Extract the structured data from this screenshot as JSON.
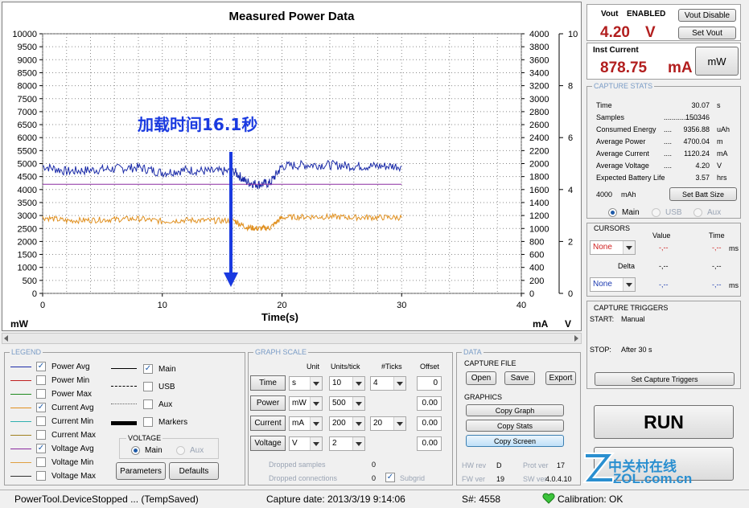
{
  "chart": {
    "title": "Measured Power Data",
    "annotation": "加载时间16.1秒",
    "xlabel": "Time(s)",
    "left_unit": "mW",
    "right_unit_1": "mA",
    "right_unit_2": "V",
    "x_ticks": [
      "0",
      "10",
      "20",
      "30",
      "40"
    ],
    "left_ticks": [
      "10000",
      "9500",
      "9000",
      "8500",
      "8000",
      "7500",
      "7000",
      "6500",
      "6000",
      "5500",
      "5000",
      "4500",
      "4000",
      "3500",
      "3000",
      "2500",
      "2000",
      "1500",
      "1000",
      "500",
      "0"
    ],
    "mid_ticks": [
      "4000",
      "3800",
      "3600",
      "3400",
      "3200",
      "3000",
      "2800",
      "2600",
      "2400",
      "2200",
      "2000",
      "1800",
      "1600",
      "1400",
      "1200",
      "1000",
      "800",
      "600",
      "400",
      "200",
      "0"
    ],
    "right_ticks": [
      "10",
      "8",
      "6",
      "4",
      "2",
      "0"
    ]
  },
  "chart_data": {
    "type": "line",
    "title": "Measured Power Data",
    "xlabel": "Time(s)",
    "ylabel": "mW",
    "xlim": [
      0,
      40
    ],
    "ylim": [
      0,
      10000
    ],
    "grid": true,
    "series": [
      {
        "name": "Power Avg",
        "color": "#1c2ca8",
        "x": [
          0,
          2,
          4,
          6,
          8,
          10,
          12,
          14,
          16,
          17,
          18,
          19,
          20,
          22,
          24,
          26,
          28,
          30
        ],
        "values": [
          4900,
          4700,
          4750,
          4800,
          4850,
          4650,
          4750,
          4700,
          4700,
          4300,
          4200,
          4250,
          4900,
          4950,
          4950,
          4900,
          4900,
          4900
        ]
      },
      {
        "name": "Voltage Avg",
        "color": "#8a2ba0",
        "x": [
          0,
          30
        ],
        "values": [
          4.2,
          4.2
        ]
      },
      {
        "name": "Current Avg",
        "color": "#e09020",
        "x": [
          0,
          2,
          4,
          6,
          8,
          10,
          12,
          14,
          16,
          17,
          18,
          19,
          20,
          22,
          24,
          26,
          28,
          30
        ],
        "values": [
          1170,
          1120,
          1130,
          1140,
          1150,
          1110,
          1130,
          1120,
          1120,
          1020,
          1000,
          1010,
          1170,
          1180,
          1180,
          1170,
          1170,
          1170
        ]
      }
    ]
  },
  "top_right": {
    "vout_label": "Vout",
    "vout_state": "ENABLED",
    "vout_value": "4.20",
    "vout_unit": "V",
    "vout_disable": "Vout Disable",
    "set_vout": "Set Vout",
    "inst_current_label": "Inst Current",
    "inst_current_value": "878.75",
    "inst_current_unit": "mA",
    "mw_button": "mW"
  },
  "capture_stats": {
    "title": "CAPTURE STATS",
    "rows": [
      {
        "label": "Time",
        "dots": "",
        "value": "30.07",
        "unit": "s"
      },
      {
        "label": "Samples",
        "dots": "..................",
        "value": "150346",
        "unit": ""
      },
      {
        "label": "Consumed Energy",
        "dots": "....",
        "value": "9356.88",
        "unit": "uAh"
      },
      {
        "label": "Average Power",
        "dots": "....",
        "value": "4700.04",
        "unit": "m"
      },
      {
        "label": "Average Current",
        "dots": "....",
        "value": "1120.24",
        "unit": "mA"
      },
      {
        "label": "Average Voltage",
        "dots": "....",
        "value": "4.20",
        "unit": "V"
      },
      {
        "label": "Expected Battery Life",
        "dots": "",
        "value": "3.57",
        "unit": "hrs"
      }
    ],
    "battery_value": "4000",
    "battery_unit": "mAh",
    "set_batt": "Set Batt Size",
    "radio_main": "Main",
    "radio_usb": "USB",
    "radio_aux": "Aux"
  },
  "cursors": {
    "title": "CURSORS",
    "col_value": "Value",
    "col_time": "Time",
    "col_delta": "Delta",
    "sel1": "None",
    "sel2": "None",
    "v1": "-,--",
    "t1": "-,--",
    "u1": "ms",
    "v2": "-,--",
    "t2": "-,--",
    "d1": "-,--",
    "d2": "-,--",
    "v3": "-,--",
    "t3": "-,--",
    "u3": "ms"
  },
  "triggers": {
    "title": "CAPTURE TRIGGERS",
    "start_label": "START:",
    "start_value": "Manual",
    "stop_label": "STOP:",
    "stop_value": "After 30 s",
    "set_button": "Set Capture Triggers"
  },
  "run_button": "RUN",
  "legend": {
    "title": "LEGEND",
    "items": [
      {
        "label": "Power Avg",
        "color": "#1c2ca8",
        "checked": "✓"
      },
      {
        "label": "Power Min",
        "color": "#c02020",
        "checked": ""
      },
      {
        "label": "Power Max",
        "color": "#208a20",
        "checked": ""
      },
      {
        "label": "Current Avg",
        "color": "#e09020",
        "checked": "✓"
      },
      {
        "label": "Current Min",
        "color": "#30b0b0",
        "checked": ""
      },
      {
        "label": "Current Max",
        "color": "#a08020",
        "checked": ""
      },
      {
        "label": "Voltage Avg",
        "color": "#8a2ba0",
        "checked": "✓"
      },
      {
        "label": "Voltage Min",
        "color": "#e0a040",
        "checked": ""
      },
      {
        "label": "Voltage Max",
        "color": "#303030",
        "checked": ""
      }
    ],
    "sources": [
      {
        "label": "Main",
        "checked": "✓"
      },
      {
        "label": "USB",
        "checked": ""
      },
      {
        "label": "Aux",
        "checked": ""
      },
      {
        "label": "Markers",
        "checked": ""
      }
    ],
    "voltage_title": "VOLTAGE",
    "voltage_main": "Main",
    "voltage_aux": "Aux",
    "parameters": "Parameters",
    "defaults": "Defaults"
  },
  "graph_scale": {
    "title": "GRAPH SCALE",
    "h_unit": "Unit",
    "h_units_tick": "Units/tick",
    "h_ticks": "#Ticks",
    "h_offset": "Offset",
    "rows": [
      {
        "name": "Time",
        "unit": "s",
        "per_tick": "10",
        "ticks": "4",
        "offset": "0"
      },
      {
        "name": "Power",
        "unit": "mW",
        "per_tick": "500",
        "ticks": "",
        "offset": "0.00"
      },
      {
        "name": "Current",
        "unit": "mA",
        "per_tick": "200",
        "ticks": "20",
        "offset": "0.00"
      },
      {
        "name": "Voltage",
        "unit": "V",
        "per_tick": "2",
        "ticks": "",
        "offset": "0.00"
      }
    ],
    "dropped_samples": "Dropped samples",
    "dropped_samples_val": "0",
    "dropped_conn": "Dropped connections",
    "dropped_conn_val": "0",
    "subgrid": "Subgrid"
  },
  "data_panel": {
    "title": "DATA",
    "capture_file": "CAPTURE FILE",
    "open": "Open",
    "save": "Save",
    "export": "Export",
    "graphics": "GRAPHICS",
    "copy_graph": "Copy Graph",
    "copy_stats": "Copy Stats",
    "copy_screen": "Copy Screen",
    "hw_rev_label": "HW rev",
    "hw_rev": "D",
    "prot_ver_label": "Prot ver",
    "prot_ver": "17",
    "fw_ver_label": "FW ver",
    "fw_ver": "19",
    "sw_ver_label": "SW ver",
    "sw_ver": "4.0.4.10"
  },
  "watermark": {
    "line1": "中关村在线",
    "line2": "ZOL.com.cn"
  },
  "status": {
    "left": "PowerTool.DeviceStopped ... (TempSaved)",
    "capture_date": "Capture date: 2013/3/19 9:14:06",
    "serial": "S#: 4558",
    "calibration": "Calibration: OK"
  }
}
